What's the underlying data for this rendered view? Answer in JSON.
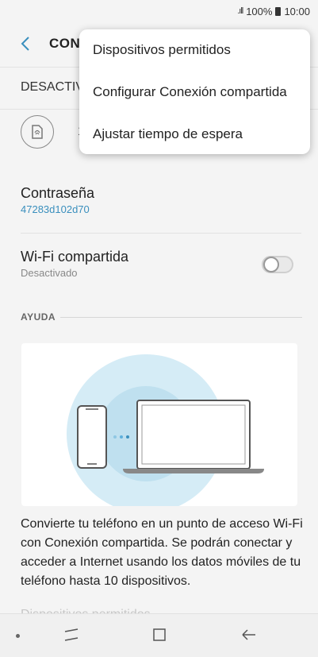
{
  "status_bar": {
    "signal": ".ıll",
    "battery_text": "100%",
    "time": "10:00"
  },
  "header": {
    "title": "CONI"
  },
  "toggle": {
    "label": "DESACTIV"
  },
  "feature": {
    "label": "1"
  },
  "password": {
    "title": "Contraseña",
    "value": "47283d102d70"
  },
  "wifi_share": {
    "title": "Wi-Fi compartida",
    "subtitle": "Desactivado",
    "enabled": false
  },
  "help": {
    "header": "AYUDA",
    "text": "Convierte tu teléfono en un punto de acceso Wi-Fi con Conexión compartida. Se podrán conectar y acceder a Internet usando los datos móviles de tu teléfono hasta 10 dispositivos.",
    "text_partial": "Dispositivos permitidos..."
  },
  "menu": {
    "items": [
      "Dispositivos permitidos",
      "Configurar Conexión compartida",
      "Ajustar tiempo de espera"
    ]
  },
  "colors": {
    "accent": "#3a8fbd",
    "background": "#f4f4f4",
    "illustration_blue": "#cfe9f4"
  },
  "icons": [
    "signal-icon",
    "battery-icon",
    "back-arrow-icon",
    "hotspot-icon",
    "phone-illustration",
    "laptop-illustration",
    "recents-icon",
    "home-icon",
    "back-nav-icon"
  ]
}
